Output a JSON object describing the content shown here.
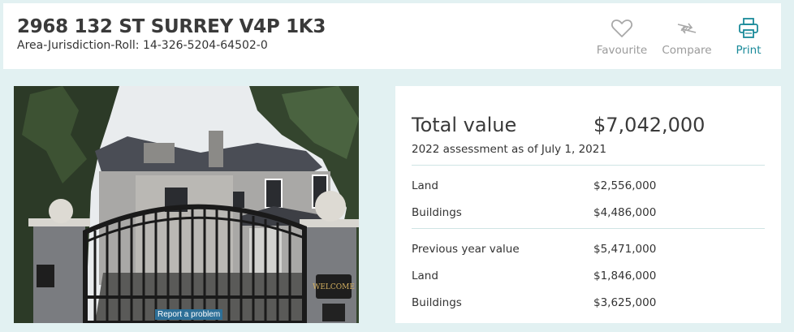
{
  "header": {
    "title": "2968 132 ST SURREY V4P 1K3",
    "roll_label": "Area-Jurisdiction-Roll: 14-326-5204-64502-0",
    "actions": [
      {
        "label": "Favourite",
        "icon": "heart-icon"
      },
      {
        "label": "Compare",
        "icon": "compare-arrows-icon"
      },
      {
        "label": "Print",
        "icon": "printer-icon"
      }
    ]
  },
  "photo": {
    "report_label": "Report a problem",
    "gate_sign_text": "WELCOME 2968"
  },
  "assessment": {
    "total_label": "Total value",
    "total_value": "$7,042,000",
    "as_of": "2022 assessment as of July 1, 2021",
    "current": [
      {
        "label": "Land",
        "value": "$2,556,000"
      },
      {
        "label": "Buildings",
        "value": "$4,486,000"
      }
    ],
    "previous_label": "Previous year value",
    "previous_value": "$5,471,000",
    "previous": [
      {
        "label": "Land",
        "value": "$1,846,000"
      },
      {
        "label": "Buildings",
        "value": "$3,625,000"
      }
    ]
  },
  "colors": {
    "background": "#e2f1f2",
    "accent": "#1a8a9a",
    "muted": "#9b9b9b",
    "report_button": "#2d6f97"
  }
}
